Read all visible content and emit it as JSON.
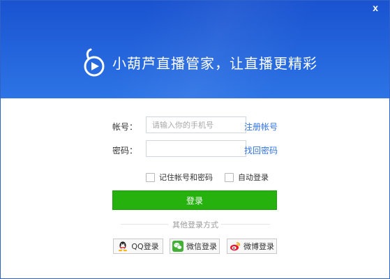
{
  "window": {
    "close_label": "x"
  },
  "header": {
    "slogan": "小葫芦直播管家，让直播更精彩"
  },
  "form": {
    "account_label": "帐号：",
    "account_value": "",
    "account_placeholder": "请输入你的手机号",
    "register_link": "注册帐号",
    "password_label": "密码：",
    "password_value": "",
    "password_placeholder": "",
    "forgot_link": "找回密码",
    "remember_label": "记住帐号和密码",
    "auto_login_label": "自动登录",
    "login_button": "登录"
  },
  "other_login": {
    "title": "其他登录方式",
    "options": [
      {
        "label": "QQ登录",
        "icon": "qq-icon"
      },
      {
        "label": "微信登录",
        "icon": "wechat-icon"
      },
      {
        "label": "微博登录",
        "icon": "weibo-icon"
      }
    ]
  },
  "colors": {
    "header_blue": "#2464dc",
    "login_green": "#26b10f",
    "link_blue": "#2f73e0"
  }
}
